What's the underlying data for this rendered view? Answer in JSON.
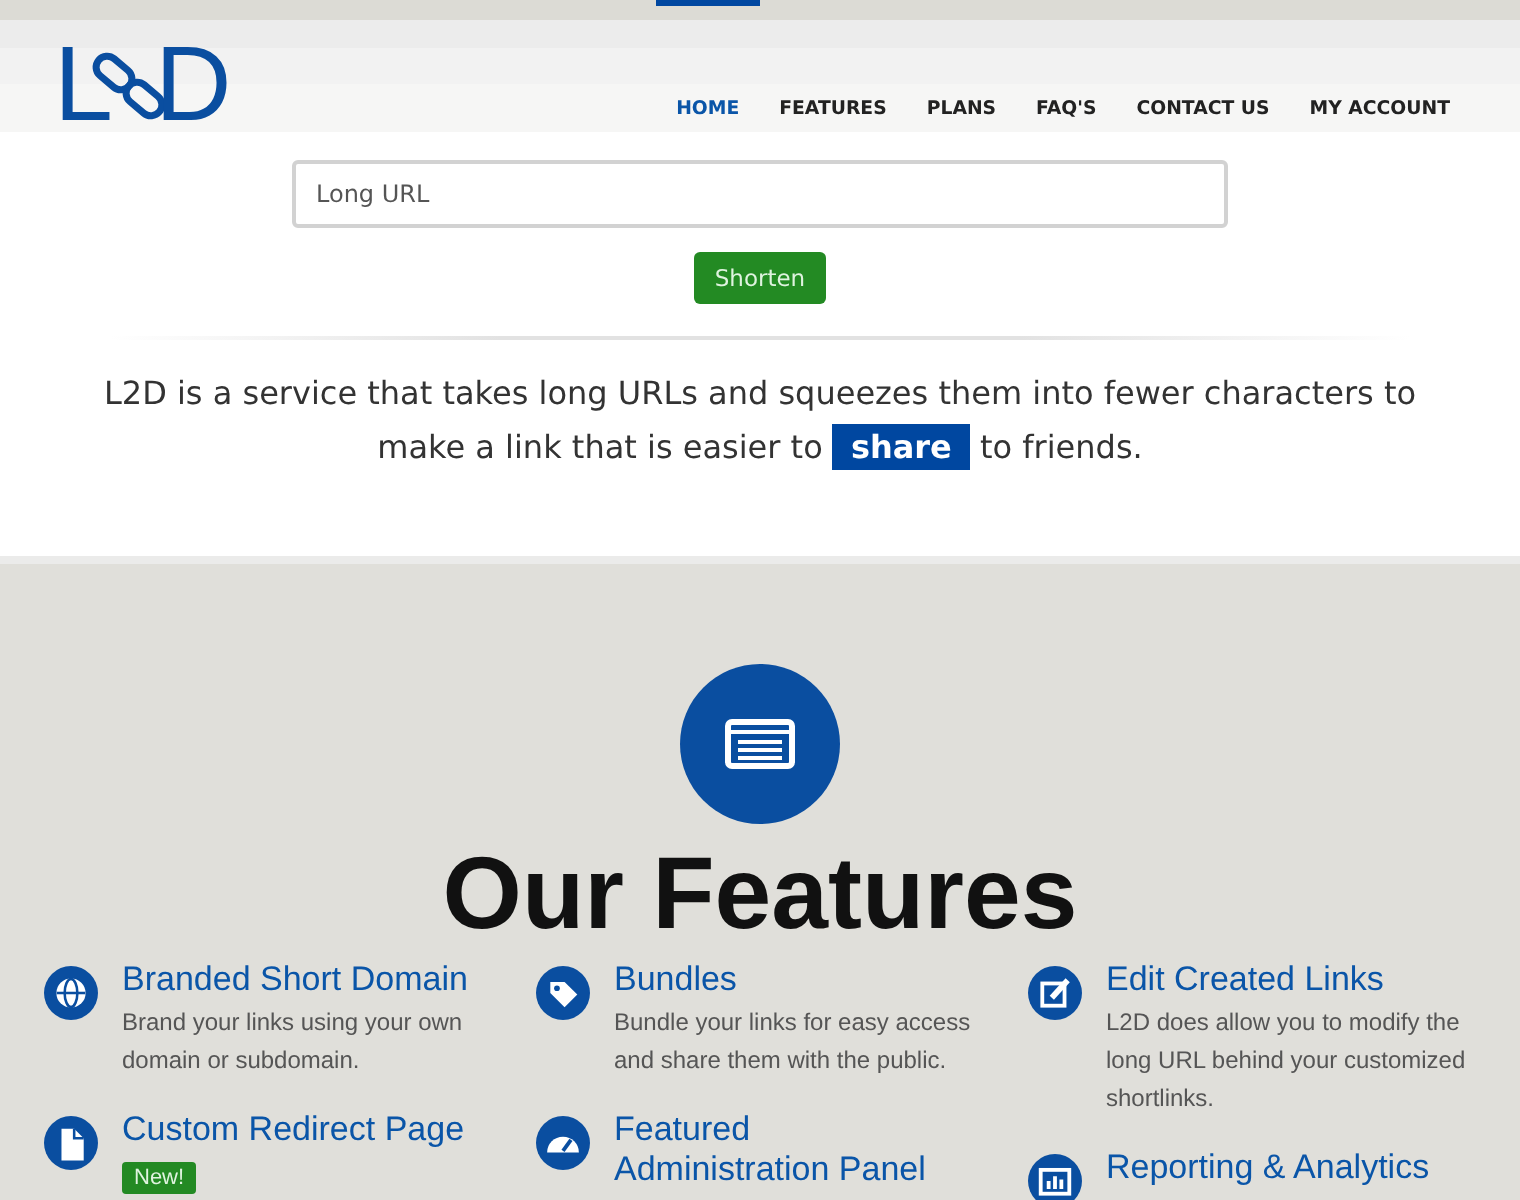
{
  "header": {
    "logo": {
      "left_letter": "L",
      "right_letter": "D"
    },
    "nav": [
      {
        "label": "HOME",
        "selected": true
      },
      {
        "label": "FEATURES",
        "selected": false
      },
      {
        "label": "PLANS",
        "selected": false
      },
      {
        "label": "FAQ'S",
        "selected": false
      },
      {
        "label": "CONTACT US",
        "selected": false
      },
      {
        "label": "MY ACCOUNT",
        "selected": false
      }
    ]
  },
  "shortener": {
    "url_field": {
      "placeholder": "Long URL"
    },
    "button": "Shorten",
    "intro": "L2D is a service that takes long URLs and squeezes them into fewer characters to make a link that is easier to **share** to friends."
  },
  "features": {
    "heading": "Our Features",
    "items": [
      {
        "title": "Branded Short Domain",
        "description": "Brand your links using your own domain or subdomain."
      },
      {
        "title": "Bundles",
        "description": "Bundle your links for easy access and share them with the public."
      },
      {
        "title": "Edit Created Links",
        "description": "L2D does allow you to modify the long URL behind your customized shortlinks."
      },
      {
        "title": "Custom Redirect Page",
        "badge": "New!"
      },
      {
        "title": "Featured Administration Panel"
      },
      {
        "title": "Reporting & Analytics"
      }
    ]
  }
}
